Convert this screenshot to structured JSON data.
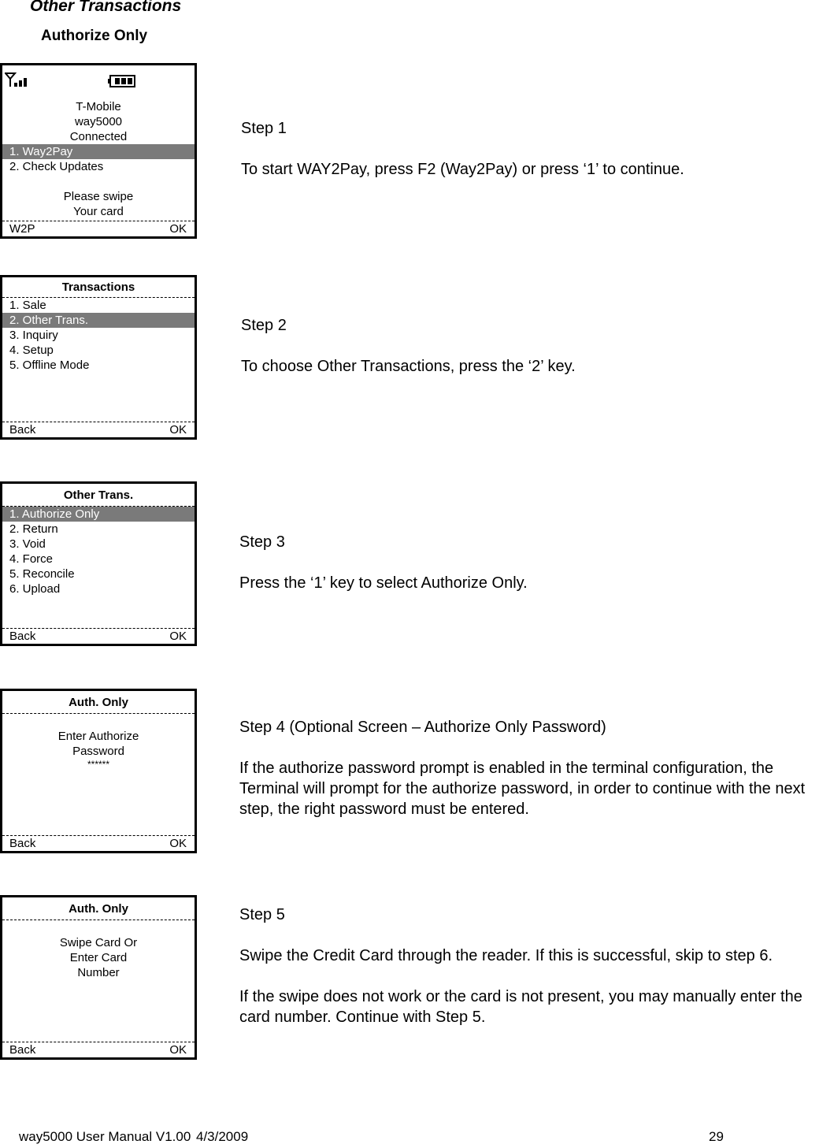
{
  "page": {
    "section_title": "Other Transactions",
    "subsection_title": "Authorize Only"
  },
  "screens": [
    {
      "status": {
        "signal_icon": "signal-antenna-icon",
        "battery_icon": "battery-icon"
      },
      "lines_top": [
        "T-Mobile",
        "way5000",
        "Connected"
      ],
      "menu": [
        {
          "label": "1. Way2Pay",
          "selected": true
        },
        {
          "label": "2. Check Updates",
          "selected": false
        }
      ],
      "lines_bottom": [
        "Please swipe",
        "Your card"
      ],
      "softkey_left": "W2P",
      "softkey_right": "OK"
    },
    {
      "title": "Transactions",
      "menu": [
        {
          "label": "1. Sale",
          "selected": false
        },
        {
          "label": "2. Other Trans.",
          "selected": true
        },
        {
          "label": "3. Inquiry",
          "selected": false
        },
        {
          "label": "4. Setup",
          "selected": false
        },
        {
          "label": "5. Offline Mode",
          "selected": false
        }
      ],
      "softkey_left": "Back",
      "softkey_right": "OK"
    },
    {
      "title": "Other Trans.",
      "menu": [
        {
          "label": "1. Authorize Only",
          "selected": true
        },
        {
          "label": "2. Return",
          "selected": false
        },
        {
          "label": "3. Void",
          "selected": false
        },
        {
          "label": "4. Force",
          "selected": false
        },
        {
          "label": "5. Reconcile",
          "selected": false
        },
        {
          "label": "6. Upload",
          "selected": false
        }
      ],
      "softkey_left": "Back",
      "softkey_right": "OK"
    },
    {
      "title": "Auth. Only",
      "lines": [
        "Enter Authorize",
        "Password"
      ],
      "masked_input": "******",
      "softkey_left": "Back",
      "softkey_right": "OK"
    },
    {
      "title": "Auth. Only",
      "lines": [
        "Swipe Card Or",
        "Enter Card",
        "Number"
      ],
      "softkey_left": "Back",
      "softkey_right": "OK"
    }
  ],
  "steps": [
    {
      "heading": "Step 1",
      "paragraphs": [
        "To start WAY2Pay, press F2 (Way2Pay) or press ‘1’ to continue."
      ]
    },
    {
      "heading": "Step 2",
      "paragraphs": [
        "To choose Other Transactions, press the ‘2’ key."
      ]
    },
    {
      "heading": "Step 3",
      "paragraphs": [
        "Press the ‘1’ key to select Authorize Only."
      ]
    },
    {
      "heading": "Step 4 (Optional Screen – Authorize Only Password)",
      "paragraphs": [
        "If the authorize password prompt is enabled in the terminal configuration, the Terminal will prompt for the authorize password, in order to continue with the next step, the right password must be entered."
      ]
    },
    {
      "heading": "Step 5",
      "paragraphs": [
        "Swipe the Credit Card through the reader.  If this is successful, skip to step 6.",
        "If the swipe does not work or the card is not present, you may manually enter the card number. Continue with Step 5."
      ]
    }
  ],
  "footer": {
    "doc_name": "way5000 User Manual V1.00",
    "date": "4/3/2009",
    "page_number": "29"
  }
}
